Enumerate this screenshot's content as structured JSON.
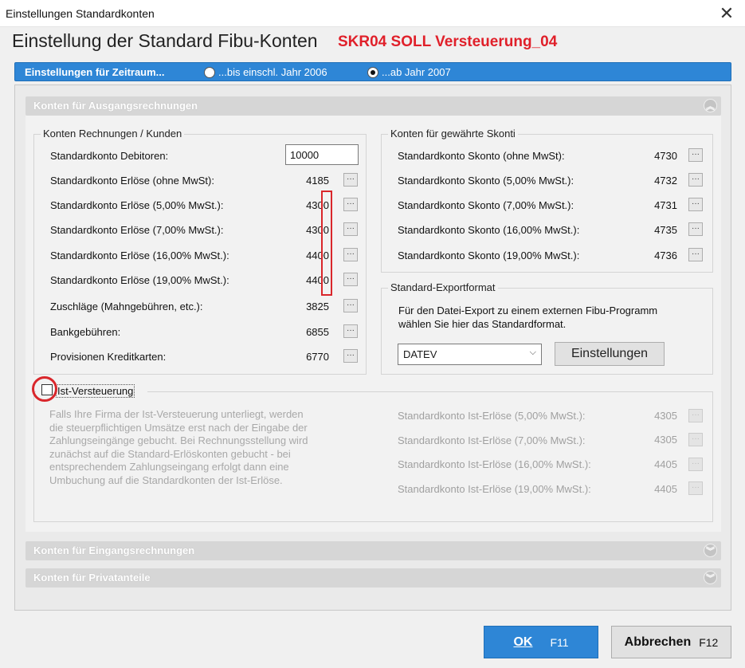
{
  "window": {
    "title": "Einstellungen Standardkonten"
  },
  "heading": "Einstellung der Standard Fibu-Konten",
  "subheading": "SKR04 SOLL Versteuerung_04",
  "period": {
    "label": "Einstellungen für Zeitraum...",
    "option1": "...bis einschl. Jahr 2006",
    "option2": "...ab Jahr 2007",
    "selected": "option2"
  },
  "sections": {
    "ausgang": "Konten für Ausgangsrechnungen",
    "eingang": "Konten für Eingangsrechnungen",
    "privat": "Konten für Privatanteile"
  },
  "kunden": {
    "title": "Konten Rechnungen / Kunden",
    "rows": [
      {
        "label": "Standardkonto Debitoren:",
        "value": "10000"
      },
      {
        "label": "Standardkonto Erlöse (ohne MwSt):",
        "value": "4185"
      },
      {
        "label": "Standardkonto Erlöse (5,00% MwSt.):",
        "value": "4300"
      },
      {
        "label": "Standardkonto Erlöse (7,00% MwSt.):",
        "value": "4300"
      },
      {
        "label": "Standardkonto Erlöse (16,00% MwSt.):",
        "value": "4400"
      },
      {
        "label": "Standardkonto Erlöse (19,00% MwSt.):",
        "value": "4400"
      },
      {
        "label": "Zuschläge (Mahngebühren, etc.):",
        "value": "3825"
      },
      {
        "label": "Bankgebühren:",
        "value": "6855"
      },
      {
        "label": "Provisionen Kreditkarten:",
        "value": "6770"
      }
    ]
  },
  "skonti": {
    "title": "Konten für gewährte Skonti",
    "rows": [
      {
        "label": "Standardkonto Skonto (ohne MwSt):",
        "value": "4730"
      },
      {
        "label": "Standardkonto Skonto (5,00% MwSt.):",
        "value": "4732"
      },
      {
        "label": "Standardkonto Skonto (7,00% MwSt.):",
        "value": "4731"
      },
      {
        "label": "Standardkonto Skonto (16,00% MwSt.):",
        "value": "4735"
      },
      {
        "label": "Standardkonto Skonto (19,00% MwSt.):",
        "value": "4736"
      }
    ]
  },
  "export": {
    "title": "Standard-Exportformat",
    "line1": "Für den Datei-Export zu einem externen Fibu-Programm",
    "line2": "wählen Sie hier das Standardformat.",
    "format": "DATEV",
    "settings_label": "Einstellungen"
  },
  "ist": {
    "checkbox_label": "Ist-Versteuerung",
    "checked": false,
    "desc_lines": [
      "Falls Ihre Firma der Ist-Versteuerung unterliegt, werden",
      "die steuerpflichtigen Umsätze erst nach der Eingabe der",
      "Zahlungseingänge gebucht. Bei Rechnungsstellung wird",
      "zunächst auf die Standard-Erlöskonten gebucht - bei",
      "entsprechendem Zahlungseingang erfolgt dann eine",
      "Umbuchung auf die Standardkonten der Ist-Erlöse."
    ],
    "rows": [
      {
        "label": "Standardkonto Ist-Erlöse (5,00% MwSt.):",
        "value": "4305"
      },
      {
        "label": "Standardkonto Ist-Erlöse (7,00% MwSt.):",
        "value": "4305"
      },
      {
        "label": "Standardkonto Ist-Erlöse (16,00% MwSt.):",
        "value": "4405"
      },
      {
        "label": "Standardkonto Ist-Erlöse (19,00% MwSt.):",
        "value": "4405"
      }
    ]
  },
  "buttons": {
    "ok": "OK",
    "ok_key": "F11",
    "cancel": "Abbrechen",
    "cancel_key": "F12",
    "dots": "···"
  },
  "colors": {
    "accent": "#2e86d6",
    "highlight": "#e0202a"
  }
}
